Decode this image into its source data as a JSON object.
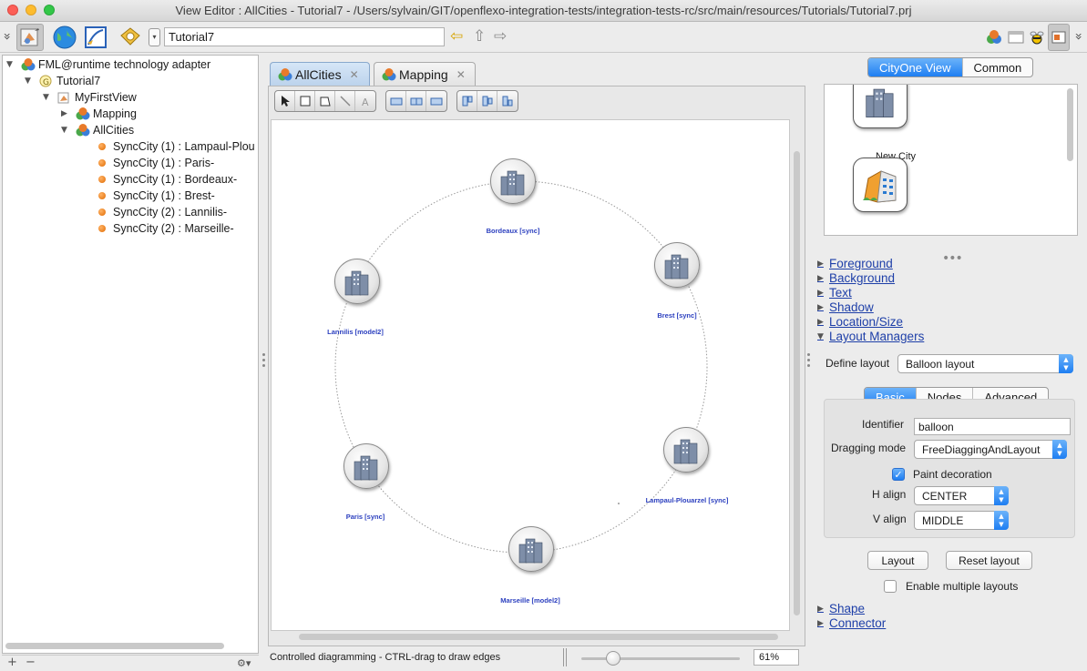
{
  "window": {
    "title": "View Editor : AllCities - Tutorial7 - /Users/sylvain/GIT/openflexo-integration-tests/integration-tests-rc/src/main/resources/Tutorials/Tutorial7.prj"
  },
  "toolbar": {
    "view_name": "Tutorial7",
    "dropdown_glyph": "▾",
    "back_glyph": "⇦",
    "up_glyph": "⇧",
    "forward_glyph": "⇨",
    "collapse_glyph": "»"
  },
  "tree": {
    "root": "FML@runtime technology adapter",
    "project": "Tutorial7",
    "view": "MyFirstView",
    "mapping": "Mapping",
    "allcities": "AllCities",
    "items": [
      "SyncCity (1) : Lampaul-Plou",
      "SyncCity (1) : Paris-",
      "SyncCity (1) : Bordeaux-",
      "SyncCity (1) : Brest-",
      "SyncCity (2) : Lannilis-",
      "SyncCity (2) : Marseille-"
    ],
    "add_label": "+",
    "remove_label": "−",
    "settings_label": "⚙▾"
  },
  "editor": {
    "tabs": [
      {
        "label": "AllCities",
        "close": "✕"
      },
      {
        "label": "Mapping",
        "close": "✕"
      }
    ],
    "nodes": [
      {
        "label": "Bordeaux [sync]"
      },
      {
        "label": "Brest [sync]"
      },
      {
        "label": "Lampaul-Plouarzel [sync]"
      },
      {
        "label": "Marseille [model2]"
      },
      {
        "label": "Paris [sync]"
      },
      {
        "label": "Lannilis [model2]"
      }
    ],
    "status_text": "Controlled diagramming - CTRL-drag to draw edges",
    "zoom_value": "61%",
    "zoom_fraction": 0.2
  },
  "inspector": {
    "palette_tabs": [
      "CityOne View",
      "Common"
    ],
    "palette_item_label": "New City",
    "sections": {
      "foreground": "Foreground",
      "background": "Background",
      "text": "Text",
      "shadow": "Shadow",
      "location": "Location/Size",
      "layout_managers": "Layout Managers",
      "shape": "Shape",
      "connector": "Connector"
    },
    "define_layout_label": "Define layout",
    "define_layout_value": "Balloon layout",
    "layout_tabs": [
      "Basic",
      "Nodes",
      "Advanced"
    ],
    "identifier_label": "Identifier",
    "identifier_value": "balloon",
    "dragging_label": "Dragging mode",
    "dragging_value": "FreeDiaggingAndLayout",
    "paint_decoration_label": "Paint decoration",
    "h_align_label": "H align",
    "h_align_value": "CENTER",
    "v_align_label": "V align",
    "v_align_value": "MIDDLE",
    "layout_button": "Layout",
    "reset_layout_button": "Reset layout",
    "multiple_layouts_label": "Enable multiple layouts"
  },
  "colors": {
    "accent": "#1e7ef2",
    "node_label": "#2b3fbf",
    "link": "#1e3fa8"
  }
}
